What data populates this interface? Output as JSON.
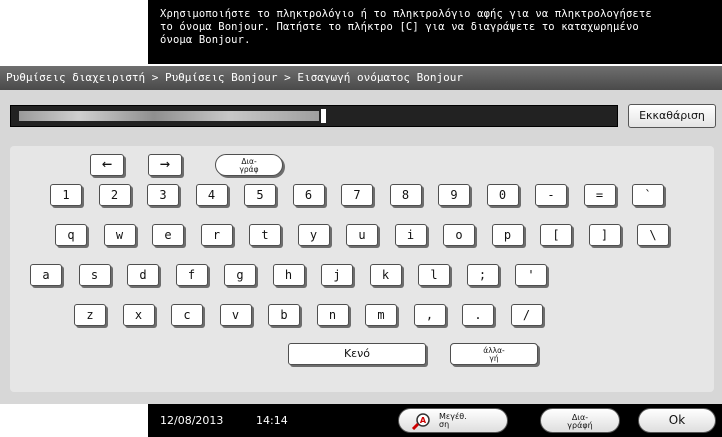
{
  "message": {
    "line1": "Χρησιμοποιήστε το πληκτρολόγιο ή το πληκτρολόγιο αφής για να πληκτρολογήσετε",
    "line2": "το όνομα Bonjour. Πατήστε το πλήκτρο [C] για να διαγράψετε το καταχωρημένο",
    "line3": "όνομα Bonjour."
  },
  "breadcrumb": "Ρυθμίσεις διαχειριστή > Ρυθμίσεις Bonjour > Εισαγωγή ονόματος Bonjour",
  "clear_label": "Εκκαθάριση",
  "keyboard": {
    "left_arrow": "←",
    "right_arrow": "→",
    "switch_top": "Δια-",
    "switch_bottom": "γράφ",
    "row1": [
      "1",
      "2",
      "3",
      "4",
      "5",
      "6",
      "7",
      "8",
      "9",
      "0",
      "-",
      "=",
      "`"
    ],
    "row2": [
      "q",
      "w",
      "e",
      "r",
      "t",
      "y",
      "u",
      "i",
      "o",
      "p",
      "[",
      "]",
      "\\"
    ],
    "row3": [
      "a",
      "s",
      "d",
      "f",
      "g",
      "h",
      "j",
      "k",
      "l",
      ";",
      "'"
    ],
    "row4": [
      "z",
      "x",
      "c",
      "v",
      "b",
      "n",
      "m",
      ",",
      ".",
      "/"
    ],
    "space_label": "Κενό",
    "other_top": "άλλα-",
    "other_bottom": "γή"
  },
  "footer": {
    "date": "12/08/2013",
    "time": "14:14",
    "zoom_top": "Μεγέθ.",
    "zoom_bottom": "ση",
    "switch_top": "Δια-",
    "switch_bottom": "γράφή",
    "ok_label": "Ok"
  }
}
